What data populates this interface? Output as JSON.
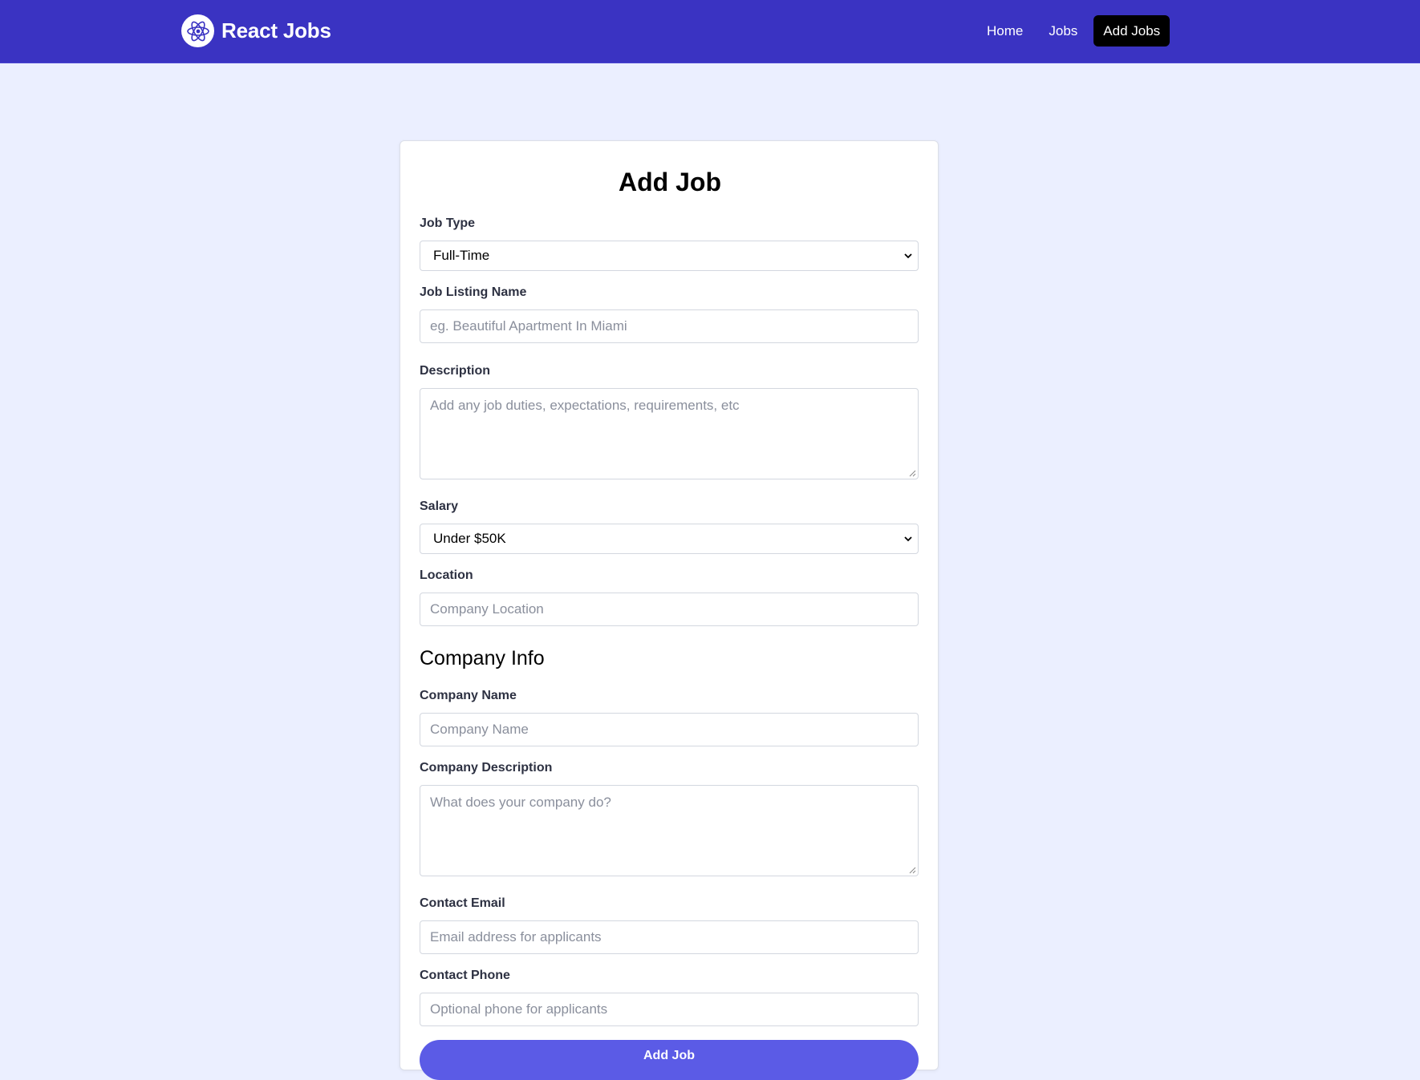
{
  "brand": {
    "name": "React Jobs",
    "logo_icon": "react-atom-icon"
  },
  "nav": {
    "items": [
      {
        "label": "Home",
        "active": false
      },
      {
        "label": "Jobs",
        "active": false
      },
      {
        "label": "Add Jobs",
        "active": true
      }
    ]
  },
  "form": {
    "title": "Add Job",
    "job_type": {
      "label": "Job Type",
      "value": "Full-Time"
    },
    "listing_name": {
      "label": "Job Listing Name",
      "placeholder": "eg. Beautiful Apartment In Miami"
    },
    "description": {
      "label": "Description",
      "placeholder": "Add any job duties, expectations, requirements, etc"
    },
    "salary": {
      "label": "Salary",
      "value": "Under $50K"
    },
    "location": {
      "label": "Location",
      "placeholder": "Company Location"
    },
    "company_section_title": "Company Info",
    "company_name": {
      "label": "Company Name",
      "placeholder": "Company Name"
    },
    "company_description": {
      "label": "Company Description",
      "placeholder": "What does your company do?"
    },
    "contact_email": {
      "label": "Contact Email",
      "placeholder": "Email address for applicants"
    },
    "contact_phone": {
      "label": "Contact Phone",
      "placeholder": "Optional phone for applicants"
    },
    "submit_label": "Add Job"
  },
  "colors": {
    "navbar": "#3a33c2",
    "page_background": "#ebefff",
    "active_nav": "#000000",
    "submit_button": "#5b5be6"
  }
}
